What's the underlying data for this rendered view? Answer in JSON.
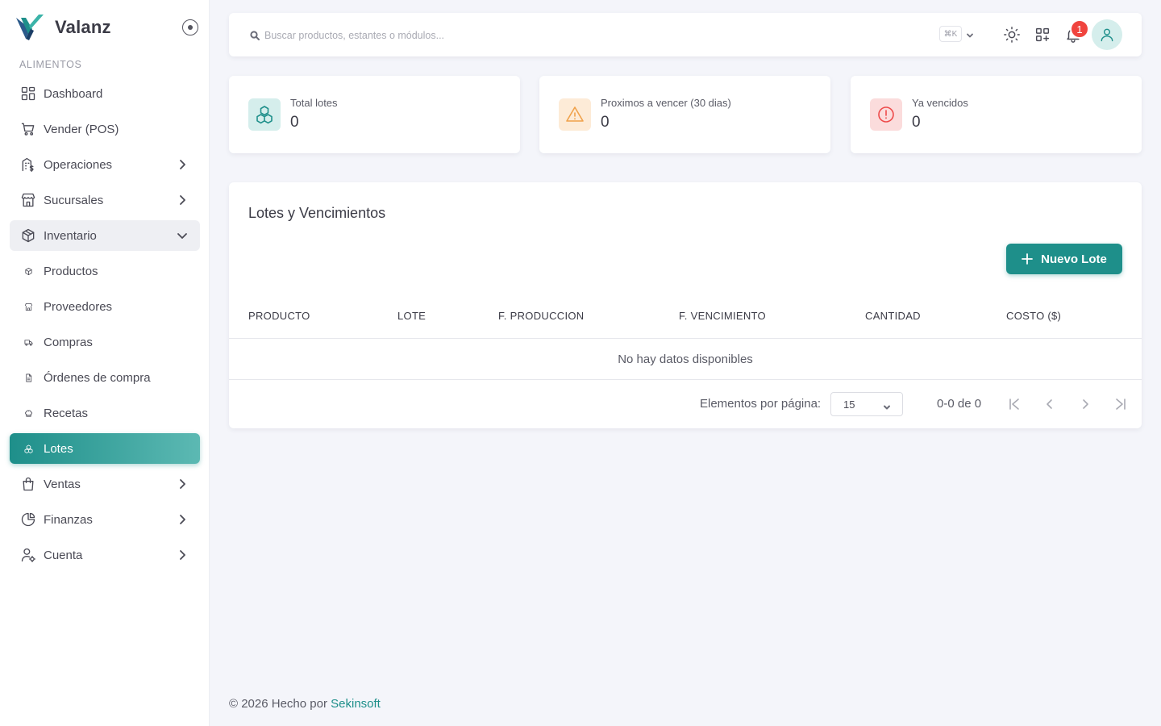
{
  "brand": {
    "name": "Valanz"
  },
  "sidebar": {
    "section_label": "ALIMENTOS",
    "items": [
      {
        "label": "Dashboard"
      },
      {
        "label": "Vender (POS)"
      },
      {
        "label": "Operaciones"
      },
      {
        "label": "Sucursales"
      },
      {
        "label": "Inventario"
      },
      {
        "label": "Productos"
      },
      {
        "label": "Proveedores"
      },
      {
        "label": "Compras"
      },
      {
        "label": "Órdenes de compra"
      },
      {
        "label": "Recetas"
      },
      {
        "label": "Lotes"
      },
      {
        "label": "Ventas"
      },
      {
        "label": "Finanzas"
      },
      {
        "label": "Cuenta"
      }
    ]
  },
  "topbar": {
    "search_placeholder": "Buscar productos, estantes o módulos...",
    "shortcut": "⌘K",
    "notification_count": "1"
  },
  "stats": [
    {
      "label": "Total lotes",
      "value": "0",
      "icon": "cubes-icon",
      "color": "#1e8f8a",
      "bg": "#d5eeec"
    },
    {
      "label": "Proximos a vencer (30 dias)",
      "value": "0",
      "icon": "warning-icon",
      "color": "#f0a24b",
      "bg": "#fdebd7"
    },
    {
      "label": "Ya vencidos",
      "value": "0",
      "icon": "alert-circle-icon",
      "color": "#ee4b4b",
      "bg": "#fbdcdc"
    }
  ],
  "main": {
    "title": "Lotes y Vencimientos",
    "new_button": "Nuevo Lote",
    "columns": [
      "PRODUCTO",
      "LOTE",
      "F. PRODUCCION",
      "F. VENCIMIENTO",
      "CANTIDAD",
      "COSTO ($)"
    ],
    "empty_text": "No hay datos disponibles",
    "pager": {
      "label": "Elementos por página:",
      "per_page": "15",
      "range": "0-0 de 0"
    }
  },
  "footer": {
    "text": "© 2026 Hecho por",
    "link": "Sekinsoft"
  },
  "colors": {
    "accent": "#1e8f8a",
    "background": "#f4f5fa",
    "danger": "#f0443e"
  }
}
